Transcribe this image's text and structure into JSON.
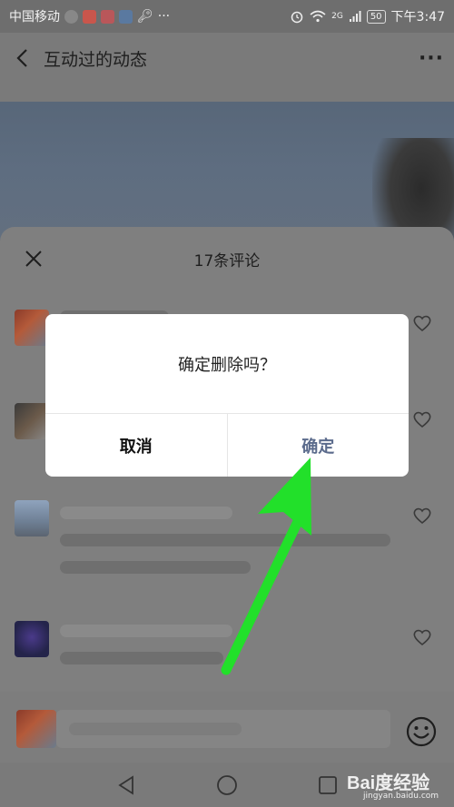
{
  "status_bar": {
    "carrier": "中国移动",
    "network": "2G",
    "battery": "50",
    "time": "下午3:47",
    "overflow": "···"
  },
  "header": {
    "title": "互动过的动态",
    "more": "···"
  },
  "sheet": {
    "title": "17条评论"
  },
  "comments": [
    {
      "avatar": "avatar-1"
    },
    {
      "avatar": "avatar-2"
    },
    {
      "avatar": "avatar-3"
    },
    {
      "avatar": "avatar-4"
    }
  ],
  "dialog": {
    "message": "确定删除吗？",
    "cancel_label": "取消",
    "confirm_label": "确定"
  },
  "watermark": {
    "brand": "Bai度经验",
    "url": "jingyan.baidu.com"
  },
  "colors": {
    "dialog_confirm": "#5b6b8c",
    "annotation_arrow": "#22e02a",
    "overlay": "#7a7a7a"
  },
  "icons": [
    "back-arrow-icon",
    "more-icon",
    "close-icon",
    "heart-icon",
    "emoji-icon",
    "nav-back-icon",
    "nav-home-icon",
    "nav-recents-icon",
    "wifi-icon",
    "alarm-icon",
    "signal-icon",
    "battery-icon"
  ]
}
